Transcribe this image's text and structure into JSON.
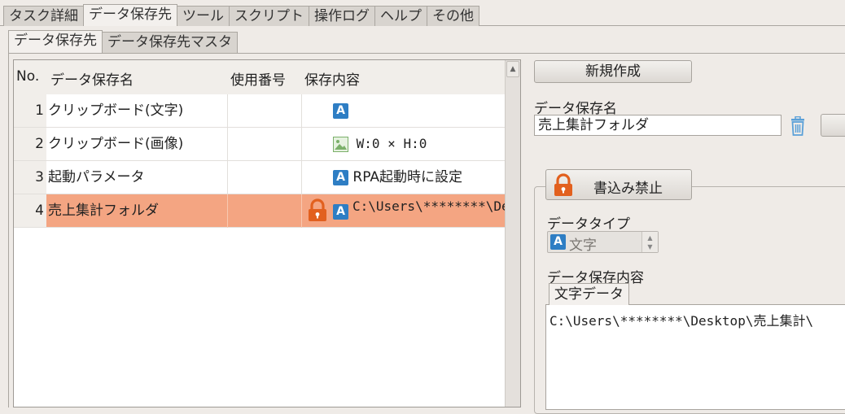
{
  "top_tabs": [
    "タスク詳細",
    "データ保存先",
    "ツール",
    "スクリプト",
    "操作ログ",
    "ヘルプ",
    "その他"
  ],
  "sub_tabs": [
    "データ保存先",
    "データ保存先マスタ"
  ],
  "table": {
    "headers": {
      "no": "No.",
      "name": "データ保存名",
      "usage": "使用番号",
      "content": "保存内容"
    },
    "rows": [
      {
        "no": "1",
        "name": "クリップボード(文字)",
        "usage": "",
        "content": ""
      },
      {
        "no": "2",
        "name": "クリップボード(画像)",
        "usage": "",
        "content": "W:0 × H:0"
      },
      {
        "no": "3",
        "name": "起動パラメータ",
        "usage": "",
        "content": "RPA起動時に設定"
      },
      {
        "no": "4",
        "name": "売上集計フォルダ",
        "usage": "",
        "content": "C:\\Users\\********\\Desktop\\"
      }
    ],
    "selected_index": 3
  },
  "panel": {
    "new_button": "新規作成",
    "name_label": "データ保存名",
    "name_value": "売上集計フォルダ",
    "lock_button": "書込み禁止",
    "type_label": "データタイプ",
    "type_value": "文字",
    "content_label": "データ保存内容",
    "content_tab": "文字データ",
    "content_value": "C:\\Users\\********\\Desktop\\売上集計\\"
  },
  "colors": {
    "selected_row": "#f4a582",
    "lock": "#e2601e",
    "text_icon": "#2e7ec4"
  }
}
